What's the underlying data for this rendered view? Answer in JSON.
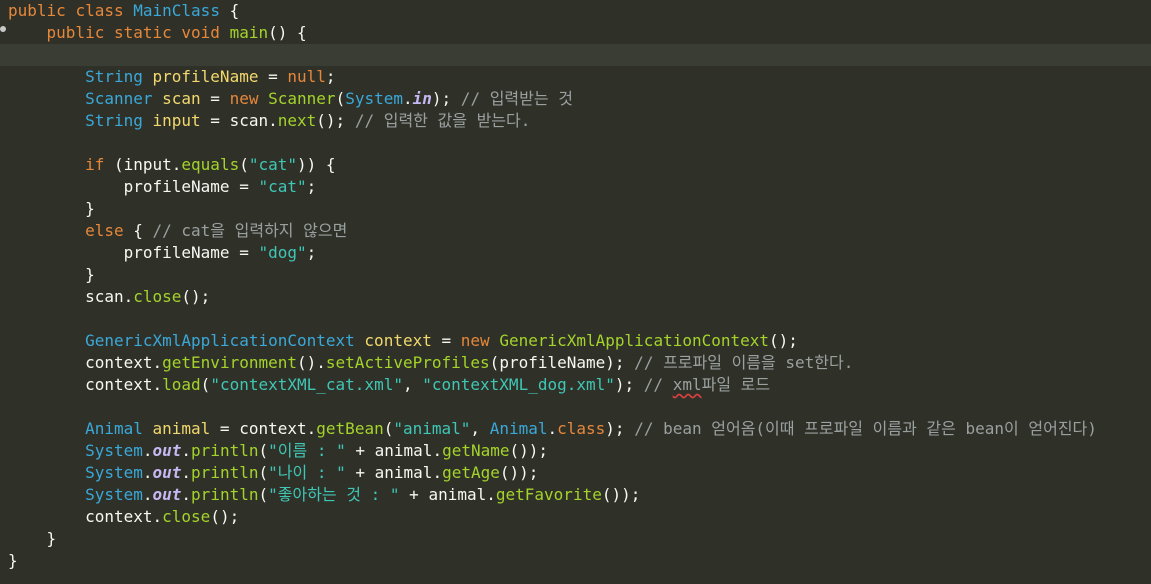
{
  "colors": {
    "background": "#2f3129",
    "current_line": "#3a3d33",
    "keyword": "#e6873a",
    "type": "#3aa8d9",
    "method": "#a4d32a",
    "identifier": "#f2d86c",
    "string": "#3fc6b5",
    "comment": "#9aa0a0",
    "static_field": "#c7b7f2"
  },
  "code": {
    "lines": [
      [
        [
          "kw",
          "public"
        ],
        [
          "punc",
          " "
        ],
        [
          "kw",
          "class"
        ],
        [
          "punc",
          " "
        ],
        [
          "type",
          "MainClass"
        ],
        [
          "punc",
          " {"
        ]
      ],
      [
        [
          "punc",
          "    "
        ],
        [
          "kw",
          "public"
        ],
        [
          "punc",
          " "
        ],
        [
          "kw",
          "static"
        ],
        [
          "punc",
          " "
        ],
        [
          "kw",
          "void"
        ],
        [
          "punc",
          " "
        ],
        [
          "fn",
          "main"
        ],
        [
          "punc",
          "() {"
        ]
      ],
      [],
      [
        [
          "punc",
          "        "
        ],
        [
          "type",
          "String"
        ],
        [
          "punc",
          " "
        ],
        [
          "id",
          "profileName"
        ],
        [
          "punc",
          " = "
        ],
        [
          "kw",
          "null"
        ],
        [
          "punc",
          ";"
        ]
      ],
      [
        [
          "punc",
          "        "
        ],
        [
          "type",
          "Scanner"
        ],
        [
          "punc",
          " "
        ],
        [
          "id",
          "scan"
        ],
        [
          "punc",
          " = "
        ],
        [
          "kw",
          "new"
        ],
        [
          "punc",
          " "
        ],
        [
          "fn",
          "Scanner"
        ],
        [
          "punc",
          "("
        ],
        [
          "type",
          "System"
        ],
        [
          "punc",
          "."
        ],
        [
          "static",
          "in"
        ],
        [
          "punc",
          ");"
        ],
        [
          "cm",
          " // 입력받는 것"
        ]
      ],
      [
        [
          "punc",
          "        "
        ],
        [
          "type",
          "String"
        ],
        [
          "punc",
          " "
        ],
        [
          "id",
          "input"
        ],
        [
          "punc",
          " = "
        ],
        [
          "var",
          "scan"
        ],
        [
          "punc",
          "."
        ],
        [
          "fn",
          "next"
        ],
        [
          "punc",
          "();"
        ],
        [
          "cm",
          " // 입력한 값을 받는다."
        ]
      ],
      [],
      [
        [
          "punc",
          "        "
        ],
        [
          "kw",
          "if"
        ],
        [
          "punc",
          " ("
        ],
        [
          "var",
          "input"
        ],
        [
          "punc",
          "."
        ],
        [
          "fn",
          "equals"
        ],
        [
          "punc",
          "("
        ],
        [
          "str",
          "\"cat\""
        ],
        [
          "punc",
          ")) {"
        ]
      ],
      [
        [
          "punc",
          "            "
        ],
        [
          "var",
          "profileName"
        ],
        [
          "punc",
          " = "
        ],
        [
          "str",
          "\"cat\""
        ],
        [
          "punc",
          ";"
        ]
      ],
      [
        [
          "punc",
          "        }"
        ]
      ],
      [
        [
          "punc",
          "        "
        ],
        [
          "kw",
          "else"
        ],
        [
          "punc",
          " {"
        ],
        [
          "cm",
          " // cat을 입력하지 않으면"
        ]
      ],
      [
        [
          "punc",
          "            "
        ],
        [
          "var",
          "profileName"
        ],
        [
          "punc",
          " = "
        ],
        [
          "str",
          "\"dog\""
        ],
        [
          "punc",
          ";"
        ]
      ],
      [
        [
          "punc",
          "        }"
        ]
      ],
      [
        [
          "punc",
          "        "
        ],
        [
          "var",
          "scan"
        ],
        [
          "punc",
          "."
        ],
        [
          "fn",
          "close"
        ],
        [
          "punc",
          "();"
        ]
      ],
      [],
      [
        [
          "punc",
          "        "
        ],
        [
          "type",
          "GenericXmlApplicationContext"
        ],
        [
          "punc",
          " "
        ],
        [
          "id",
          "context"
        ],
        [
          "punc",
          " = "
        ],
        [
          "kw",
          "new"
        ],
        [
          "punc",
          " "
        ],
        [
          "fn",
          "GenericXmlApplicationContext"
        ],
        [
          "punc",
          "();"
        ]
      ],
      [
        [
          "punc",
          "        "
        ],
        [
          "var",
          "context"
        ],
        [
          "punc",
          "."
        ],
        [
          "fn",
          "getEnvironment"
        ],
        [
          "punc",
          "()."
        ],
        [
          "fn",
          "setActiveProfiles"
        ],
        [
          "punc",
          "("
        ],
        [
          "var",
          "profileName"
        ],
        [
          "punc",
          ");"
        ],
        [
          "cm",
          " // 프로파일 이름을 set한다."
        ]
      ],
      [
        [
          "punc",
          "        "
        ],
        [
          "var",
          "context"
        ],
        [
          "punc",
          "."
        ],
        [
          "fn",
          "load"
        ],
        [
          "punc",
          "("
        ],
        [
          "str",
          "\"contextXML_cat.xml\""
        ],
        [
          "punc",
          ", "
        ],
        [
          "str",
          "\"contextXML_dog.xml\""
        ],
        [
          "punc",
          ");"
        ],
        [
          "cm",
          " // "
        ],
        [
          "cmerr",
          "xml"
        ],
        [
          "cm",
          "파일 로드"
        ]
      ],
      [],
      [
        [
          "punc",
          "        "
        ],
        [
          "type",
          "Animal"
        ],
        [
          "punc",
          " "
        ],
        [
          "id",
          "animal"
        ],
        [
          "punc",
          " = "
        ],
        [
          "var",
          "context"
        ],
        [
          "punc",
          "."
        ],
        [
          "fn",
          "getBean"
        ],
        [
          "punc",
          "("
        ],
        [
          "str",
          "\"animal\""
        ],
        [
          "punc",
          ", "
        ],
        [
          "type",
          "Animal"
        ],
        [
          "punc",
          "."
        ],
        [
          "kw",
          "class"
        ],
        [
          "punc",
          ");"
        ],
        [
          "cm",
          " // bean 얻어옴(이때 프로파일 이름과 같은 bean이 얻어진다)"
        ]
      ],
      [
        [
          "punc",
          "        "
        ],
        [
          "type",
          "System"
        ],
        [
          "punc",
          "."
        ],
        [
          "static",
          "out"
        ],
        [
          "punc",
          "."
        ],
        [
          "fn",
          "println"
        ],
        [
          "punc",
          "("
        ],
        [
          "str",
          "\"이름 : \""
        ],
        [
          "punc",
          " + "
        ],
        [
          "var",
          "animal"
        ],
        [
          "punc",
          "."
        ],
        [
          "fn",
          "getName"
        ],
        [
          "punc",
          "());"
        ]
      ],
      [
        [
          "punc",
          "        "
        ],
        [
          "type",
          "System"
        ],
        [
          "punc",
          "."
        ],
        [
          "static",
          "out"
        ],
        [
          "punc",
          "."
        ],
        [
          "fn",
          "println"
        ],
        [
          "punc",
          "("
        ],
        [
          "str",
          "\"나이 : \""
        ],
        [
          "punc",
          " + "
        ],
        [
          "var",
          "animal"
        ],
        [
          "punc",
          "."
        ],
        [
          "fn",
          "getAge"
        ],
        [
          "punc",
          "());"
        ]
      ],
      [
        [
          "punc",
          "        "
        ],
        [
          "type",
          "System"
        ],
        [
          "punc",
          "."
        ],
        [
          "static",
          "out"
        ],
        [
          "punc",
          "."
        ],
        [
          "fn",
          "println"
        ],
        [
          "punc",
          "("
        ],
        [
          "str",
          "\"좋아하는 것 : \""
        ],
        [
          "punc",
          " + "
        ],
        [
          "var",
          "animal"
        ],
        [
          "punc",
          "."
        ],
        [
          "fn",
          "getFavorite"
        ],
        [
          "punc",
          "());"
        ]
      ],
      [
        [
          "punc",
          "        "
        ],
        [
          "var",
          "context"
        ],
        [
          "punc",
          "."
        ],
        [
          "fn",
          "close"
        ],
        [
          "punc",
          "();"
        ]
      ],
      [
        [
          "punc",
          "    }"
        ]
      ],
      [
        [
          "punc",
          "}"
        ]
      ]
    ]
  }
}
